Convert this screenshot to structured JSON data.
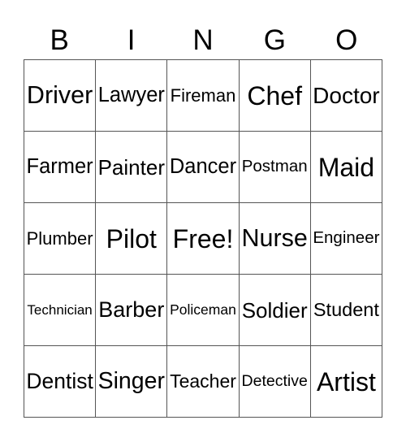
{
  "header": {
    "letters": [
      "B",
      "I",
      "N",
      "G",
      "O"
    ]
  },
  "board": {
    "rows": [
      [
        "Driver",
        "Lawyer",
        "Fireman",
        "Chef",
        "Doctor"
      ],
      [
        "Farmer",
        "Painter",
        "Dancer",
        "Postman",
        "Maid"
      ],
      [
        "Plumber",
        "Pilot",
        "Free!",
        "Nurse",
        "Engineer"
      ],
      [
        "Technician",
        "Barber",
        "Policeman",
        "Soldier",
        "Student"
      ],
      [
        "Dentist",
        "Singer",
        "Teacher",
        "Detective",
        "Artist"
      ]
    ]
  }
}
